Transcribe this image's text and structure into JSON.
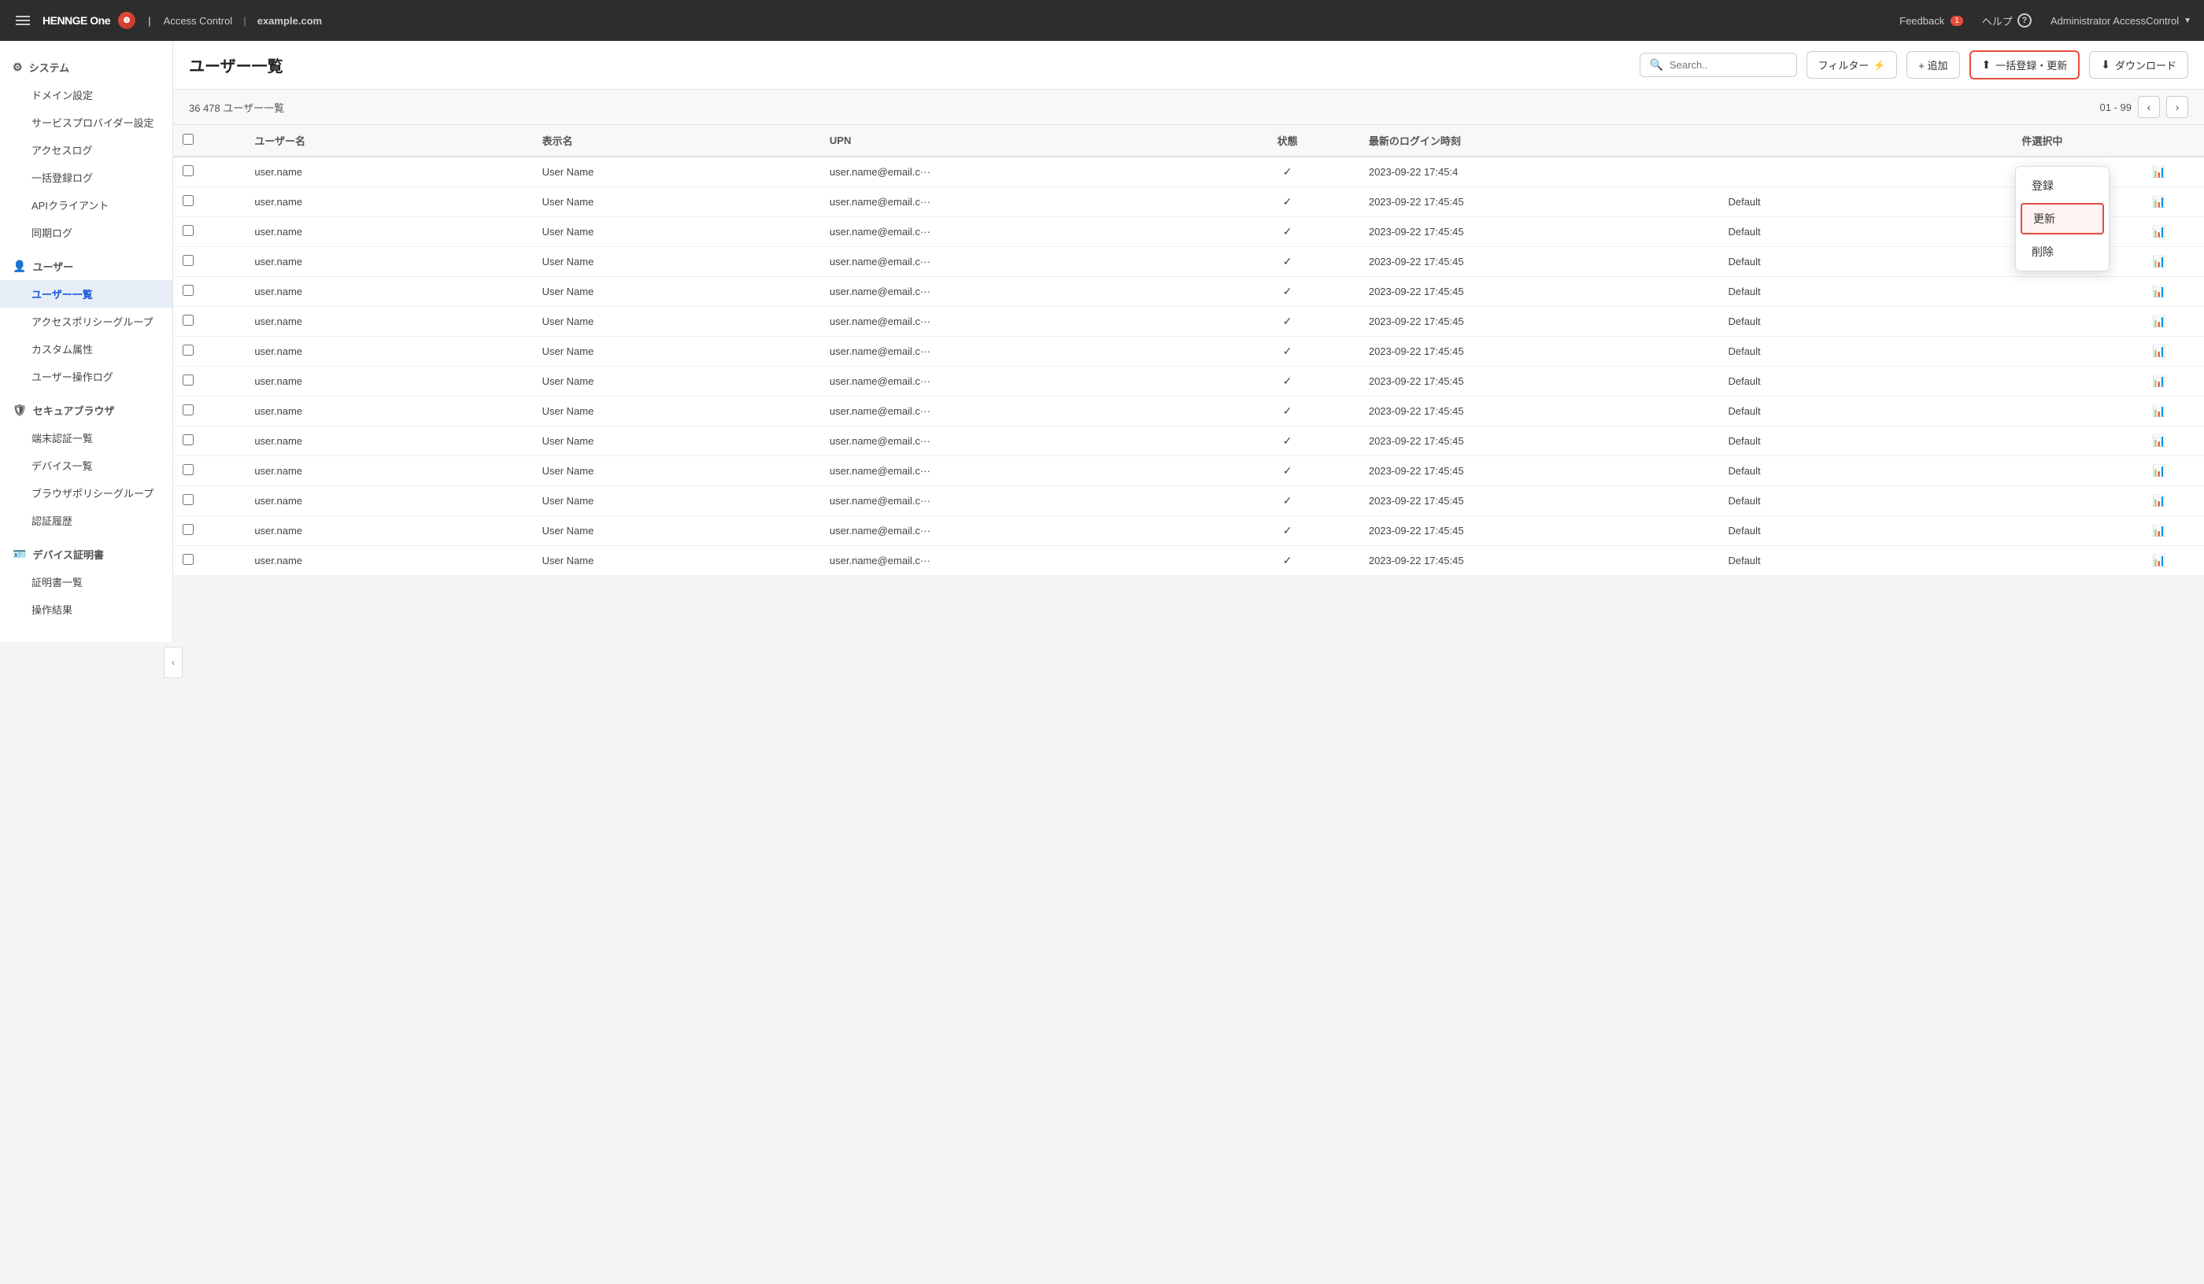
{
  "header": {
    "logo_text": "HENNGE One",
    "product": "Access Control",
    "domain": "example.com",
    "feedback_label": "Feedback",
    "feedback_count": "1",
    "help_label": "ヘルプ",
    "user_label": "Administrator AccessControl"
  },
  "sidebar": {
    "sections": [
      {
        "id": "system",
        "icon": "gear",
        "label": "システム",
        "items": [
          {
            "id": "domain-settings",
            "label": "ドメイン設定"
          },
          {
            "id": "service-provider",
            "label": "サービスプロバイダー設定"
          },
          {
            "id": "access-log",
            "label": "アクセスログ"
          },
          {
            "id": "bulk-register-log",
            "label": "一括登録ログ"
          },
          {
            "id": "api-client",
            "label": "APIクライアント"
          },
          {
            "id": "sync-log",
            "label": "同期ログ"
          }
        ]
      },
      {
        "id": "user",
        "icon": "user",
        "label": "ユーザー",
        "items": [
          {
            "id": "user-list",
            "label": "ユーザー一覧",
            "active": true
          },
          {
            "id": "access-policy-group",
            "label": "アクセスポリシーグループ"
          },
          {
            "id": "custom-attribute",
            "label": "カスタム属性"
          },
          {
            "id": "user-operation-log",
            "label": "ユーザー操作ログ"
          }
        ]
      },
      {
        "id": "secure-browser",
        "icon": "shield",
        "label": "セキュアブラウザ",
        "items": [
          {
            "id": "device-auth-list",
            "label": "端末認証一覧"
          },
          {
            "id": "device-list",
            "label": "デバイス一覧"
          },
          {
            "id": "browser-policy-group",
            "label": "ブラウザポリシーグループ"
          },
          {
            "id": "auth-history",
            "label": "認証履歴"
          }
        ]
      },
      {
        "id": "device-cert",
        "icon": "certificate",
        "label": "デバイス証明書",
        "items": [
          {
            "id": "cert-list",
            "label": "証明書一覧"
          },
          {
            "id": "operation-result",
            "label": "操作結果"
          }
        ]
      }
    ]
  },
  "main": {
    "title": "ユーザー一覧",
    "search_placeholder": "Search..",
    "filter_label": "フィルター",
    "add_label": "+ 追加",
    "bulk_register_label": "一括登録・更新",
    "download_label": "ダウンロード",
    "record_count": "36 478 ユーザー一覧",
    "pagination": {
      "range": "01 - 99"
    },
    "table": {
      "columns": [
        "ユーザー名",
        "表示名",
        "UPN",
        "状態",
        "最新のログイン時刻",
        "",
        "件選択中"
      ],
      "rows": [
        {
          "username": "user.name",
          "display_name": "User Name",
          "upn": "user.name@email.c···",
          "status": "✓",
          "last_login": "2023-09-22 17:45:4",
          "group": "",
          "selected": ""
        },
        {
          "username": "user.name",
          "display_name": "User Name",
          "upn": "user.name@email.c···",
          "status": "✓",
          "last_login": "2023-09-22 17:45:45",
          "group": "Default",
          "selected": ""
        },
        {
          "username": "user.name",
          "display_name": "User Name",
          "upn": "user.name@email.c···",
          "status": "✓",
          "last_login": "2023-09-22 17:45:45",
          "group": "Default",
          "selected": ""
        },
        {
          "username": "user.name",
          "display_name": "User Name",
          "upn": "user.name@email.c···",
          "status": "✓",
          "last_login": "2023-09-22 17:45:45",
          "group": "Default",
          "selected": ""
        },
        {
          "username": "user.name",
          "display_name": "User Name",
          "upn": "user.name@email.c···",
          "status": "✓",
          "last_login": "2023-09-22 17:45:45",
          "group": "Default",
          "selected": ""
        },
        {
          "username": "user.name",
          "display_name": "User Name",
          "upn": "user.name@email.c···",
          "status": "✓",
          "last_login": "2023-09-22 17:45:45",
          "group": "Default",
          "selected": ""
        },
        {
          "username": "user.name",
          "display_name": "User Name",
          "upn": "user.name@email.c···",
          "status": "✓",
          "last_login": "2023-09-22 17:45:45",
          "group": "Default",
          "selected": ""
        },
        {
          "username": "user.name",
          "display_name": "User Name",
          "upn": "user.name@email.c···",
          "status": "✓",
          "last_login": "2023-09-22 17:45:45",
          "group": "Default",
          "selected": ""
        },
        {
          "username": "user.name",
          "display_name": "User Name",
          "upn": "user.name@email.c···",
          "status": "✓",
          "last_login": "2023-09-22 17:45:45",
          "group": "Default",
          "selected": ""
        },
        {
          "username": "user.name",
          "display_name": "User Name",
          "upn": "user.name@email.c···",
          "status": "✓",
          "last_login": "2023-09-22 17:45:45",
          "group": "Default",
          "selected": ""
        },
        {
          "username": "user.name",
          "display_name": "User Name",
          "upn": "user.name@email.c···",
          "status": "✓",
          "last_login": "2023-09-22 17:45:45",
          "group": "Default",
          "selected": ""
        },
        {
          "username": "user.name",
          "display_name": "User Name",
          "upn": "user.name@email.c···",
          "status": "✓",
          "last_login": "2023-09-22 17:45:45",
          "group": "Default",
          "selected": ""
        },
        {
          "username": "user.name",
          "display_name": "User Name",
          "upn": "user.name@email.c···",
          "status": "✓",
          "last_login": "2023-09-22 17:45:45",
          "group": "Default",
          "selected": ""
        },
        {
          "username": "user.name",
          "display_name": "User Name",
          "upn": "user.name@email.c···",
          "status": "✓",
          "last_login": "2023-09-22 17:45:45",
          "group": "Default",
          "selected": ""
        }
      ]
    }
  },
  "dropdown": {
    "items": [
      {
        "id": "register",
        "label": "登録",
        "active": false
      },
      {
        "id": "update",
        "label": "更新",
        "active": true
      },
      {
        "id": "delete",
        "label": "削除",
        "active": false
      }
    ]
  },
  "colors": {
    "accent": "#e74c3c",
    "active_nav": "#1a56db",
    "header_bg": "#2d2d2d"
  }
}
